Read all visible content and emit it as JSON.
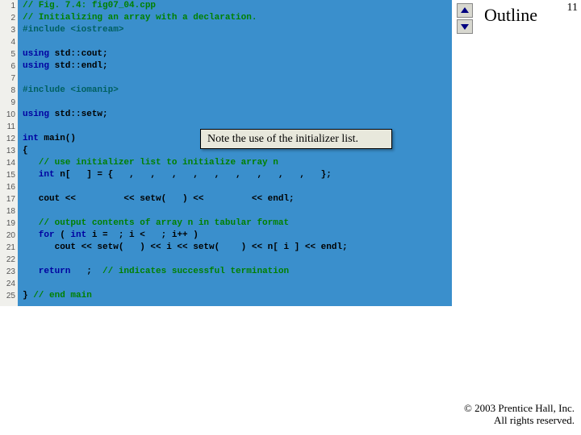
{
  "page_number": "11",
  "outline_label": "Outline",
  "nav": {
    "up_name": "previous-slide",
    "down_name": "next-slide"
  },
  "callout": "Note the use of the initializer list.",
  "copyright": {
    "line1": "© 2003 Prentice Hall, Inc.",
    "line2": "All rights reserved."
  },
  "line_count": 25,
  "code": {
    "l1": "// Fig. 7.4: fig07_04.cpp",
    "l2": "// Initializing an array with a declaration.",
    "l3a": "#include ",
    "l3b": "<iostream>",
    "l5a": "using ",
    "l5b": "std::cout;",
    "l6a": "using ",
    "l6b": "std::endl;",
    "l8a": "#include ",
    "l8b": "<iomanip>",
    "l10a": "using ",
    "l10b": "std::setw;",
    "l12a": "int ",
    "l12b": "main()",
    "l13": "{",
    "l14": "   // use initializer list to initialize array n",
    "l15a": "   int ",
    "l15b": "n[   ] = {   ,   ,   ,   ,   ,   ,   ,   ,   ,   };",
    "l17": "   cout <<         << setw(   ) <<         << endl;",
    "l19": "   // output contents of array n in tabular format",
    "l20a": "   for ",
    "l20b": "( ",
    "l20c": "int ",
    "l20d": "i =  ; i <   ; i++ )",
    "l21": "      cout << setw(   ) << i << setw(    ) << n[ i ] << endl;",
    "l23a": "   return ",
    "l23b": "  ;  ",
    "l23c": "// indicates successful termination",
    "l25a": "} ",
    "l25b": "// end main"
  }
}
